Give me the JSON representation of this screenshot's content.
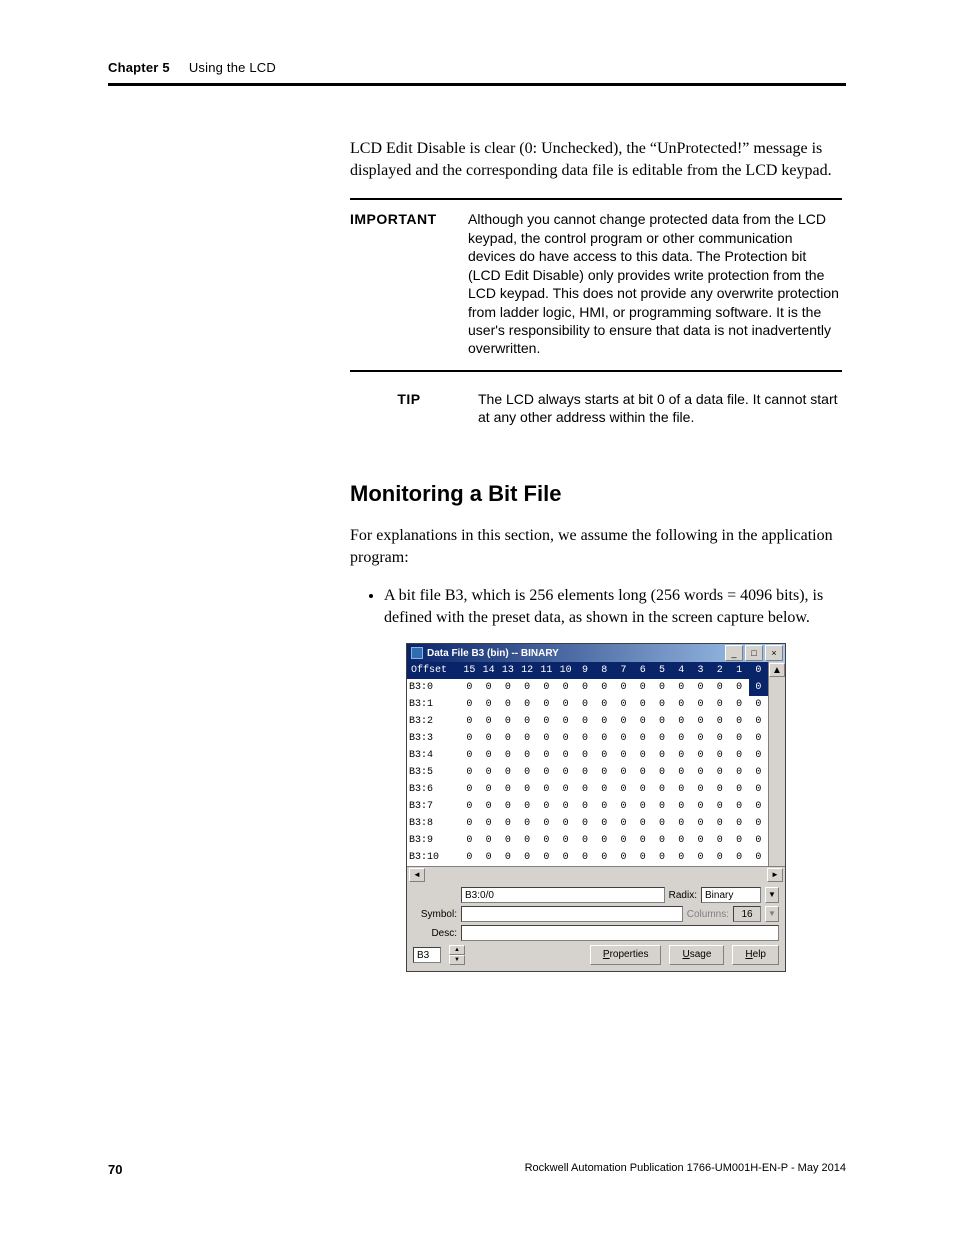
{
  "header": {
    "chapter": "Chapter 5",
    "title": "Using the LCD"
  },
  "intro": "LCD Edit Disable is clear (0: Unchecked), the “UnProtected!” message is displayed and the corresponding data file is editable from the LCD keypad.",
  "important": {
    "label": "IMPORTANT",
    "text": "Although you cannot change protected data from the LCD keypad, the control program or other communication devices do have access to this data. The Protection bit (LCD Edit Disable) only provides write protection from the LCD keypad. This does not provide any overwrite protection from ladder logic, HMI, or programming software. It is the user's responsibility to ensure that data is not inadvertently overwritten."
  },
  "tip": {
    "label": "TIP",
    "text": "The LCD always starts at bit 0 of a data file. It cannot start at any other address within the file."
  },
  "section_heading": "Monitoring a Bit File",
  "section_intro": "For explanations in this section, we assume the following in the application program:",
  "bullet": "A bit file B3, which is 256 elements long (256 words = 4096 bits), is defined with the preset data, as shown in the screen capture below.",
  "shot": {
    "title": "Data File B3 (bin)  --  BINARY",
    "headers": [
      "Offset",
      "15",
      "14",
      "13",
      "12",
      "11",
      "10",
      "9",
      "8",
      "7",
      "6",
      "5",
      "4",
      "3",
      "2",
      "1",
      "0"
    ],
    "rows": [
      {
        "label": "B3:0",
        "v": [
          "0",
          "0",
          "0",
          "0",
          "0",
          "0",
          "0",
          "0",
          "0",
          "0",
          "0",
          "0",
          "0",
          "0",
          "0",
          "0"
        ],
        "sel": true
      },
      {
        "label": "B3:1",
        "v": [
          "0",
          "0",
          "0",
          "0",
          "0",
          "0",
          "0",
          "0",
          "0",
          "0",
          "0",
          "0",
          "0",
          "0",
          "0",
          "0"
        ]
      },
      {
        "label": "B3:2",
        "v": [
          "0",
          "0",
          "0",
          "0",
          "0",
          "0",
          "0",
          "0",
          "0",
          "0",
          "0",
          "0",
          "0",
          "0",
          "0",
          "0"
        ]
      },
      {
        "label": "B3:3",
        "v": [
          "0",
          "0",
          "0",
          "0",
          "0",
          "0",
          "0",
          "0",
          "0",
          "0",
          "0",
          "0",
          "0",
          "0",
          "0",
          "0"
        ]
      },
      {
        "label": "B3:4",
        "v": [
          "0",
          "0",
          "0",
          "0",
          "0",
          "0",
          "0",
          "0",
          "0",
          "0",
          "0",
          "0",
          "0",
          "0",
          "0",
          "0"
        ]
      },
      {
        "label": "B3:5",
        "v": [
          "0",
          "0",
          "0",
          "0",
          "0",
          "0",
          "0",
          "0",
          "0",
          "0",
          "0",
          "0",
          "0",
          "0",
          "0",
          "0"
        ]
      },
      {
        "label": "B3:6",
        "v": [
          "0",
          "0",
          "0",
          "0",
          "0",
          "0",
          "0",
          "0",
          "0",
          "0",
          "0",
          "0",
          "0",
          "0",
          "0",
          "0"
        ]
      },
      {
        "label": "B3:7",
        "v": [
          "0",
          "0",
          "0",
          "0",
          "0",
          "0",
          "0",
          "0",
          "0",
          "0",
          "0",
          "0",
          "0",
          "0",
          "0",
          "0"
        ]
      },
      {
        "label": "B3:8",
        "v": [
          "0",
          "0",
          "0",
          "0",
          "0",
          "0",
          "0",
          "0",
          "0",
          "0",
          "0",
          "0",
          "0",
          "0",
          "0",
          "0"
        ]
      },
      {
        "label": "B3:9",
        "v": [
          "0",
          "0",
          "0",
          "0",
          "0",
          "0",
          "0",
          "0",
          "0",
          "0",
          "0",
          "0",
          "0",
          "0",
          "0",
          "0"
        ]
      },
      {
        "label": "B3:10",
        "v": [
          "0",
          "0",
          "0",
          "0",
          "0",
          "0",
          "0",
          "0",
          "0",
          "0",
          "0",
          "0",
          "0",
          "0",
          "0",
          "0"
        ]
      }
    ],
    "addr_value": "B3:0/0",
    "symbol_label": "Symbol:",
    "desc_label": "Desc:",
    "radix_label": "Radix:",
    "radix_value": "Binary",
    "columns_label": "Columns:",
    "columns_value": "16",
    "file_value": "B3",
    "btn_properties": "Properties",
    "btn_usage": "Usage",
    "btn_help": "Help"
  },
  "footer": {
    "page": "70",
    "pub": "Rockwell Automation Publication 1766-UM001H-EN-P - May 2014"
  }
}
